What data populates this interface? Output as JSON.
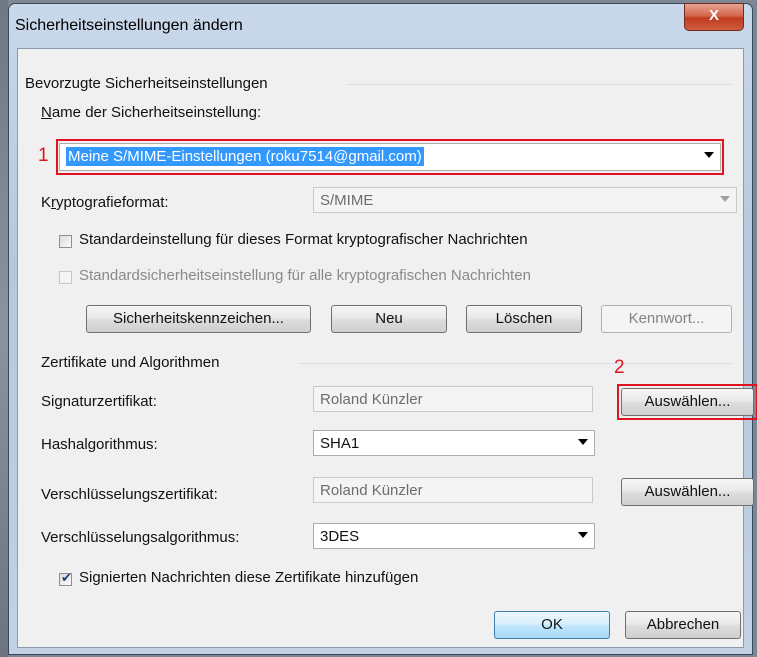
{
  "window": {
    "title": "Sicherheitseinstellungen ändern",
    "close_label": "X"
  },
  "preferred": {
    "group_label": "Bevorzugte Sicherheitseinstellungen",
    "name_label": "Name der Sicherheitseinstellung:",
    "name_value": "Meine S/MIME-Einstellungen (roku7514@gmail.com)",
    "format_label": "Kryptografieformat:",
    "format_value": "S/MIME",
    "default_format_label": "Standardeinstellung für dieses Format kryptografischer Nachrichten",
    "default_all_label": "Standardsicherheitseinstellung für alle kryptografischen Nachrichten",
    "btn_labels": "Sicherheitskennzeichen...",
    "btn_new": "Neu",
    "btn_delete": "Löschen",
    "btn_password": "Kennwort..."
  },
  "certs": {
    "group_label": "Zertifikate und Algorithmen",
    "sig_label": "Signaturzertifikat:",
    "sig_value": "Roland Künzler",
    "choose": "Auswählen...",
    "hash_label": "Hashalgorithmus:",
    "hash_value": "SHA1",
    "enc_cert_label": "Verschlüsselungszertifikat:",
    "enc_cert_value": "Roland Künzler",
    "enc_alg_label": "Verschlüsselungsalgorithmus:",
    "enc_alg_value": "3DES",
    "add_certs_label": "Signierten Nachrichten diese Zertifikate hinzufügen"
  },
  "footer": {
    "ok": "OK",
    "cancel": "Abbrechen"
  },
  "annotations": {
    "one": "1",
    "two": "2"
  },
  "colors": {
    "highlight": "#e0141e",
    "selection": "#3399ff"
  }
}
